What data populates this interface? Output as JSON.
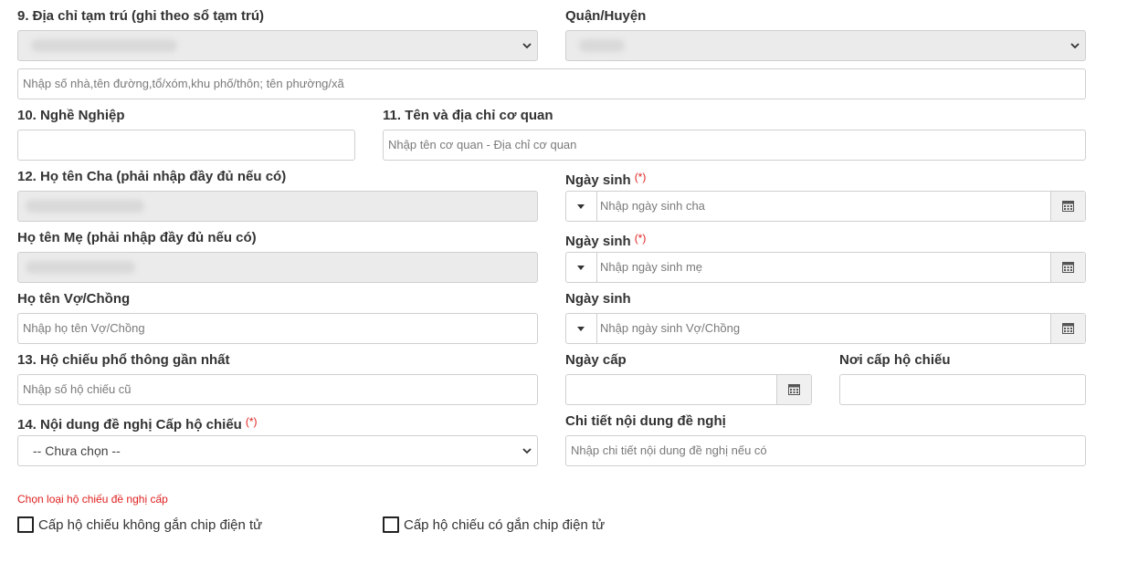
{
  "section9": {
    "label": "9. Địa chỉ tạm trú (ghi theo sổ tạm trú)",
    "district_label": "Quận/Huyện",
    "address_placeholder": "Nhập số nhà,tên đường,tổ/xóm,khu phố/thôn; tên phường/xã"
  },
  "section10": {
    "label": "10. Nghề Nghiệp"
  },
  "section11": {
    "label": "11. Tên và địa chỉ cơ quan",
    "placeholder": "Nhập tên cơ quan - Địa chỉ cơ quan"
  },
  "section12": {
    "father_label": "12. Họ tên Cha (phải nhập đầy đủ nếu có)",
    "father_dob_label": "Ngày sinh",
    "father_dob_placeholder": "Nhập ngày sinh cha",
    "mother_label": "Họ tên Mẹ (phải nhập đầy đủ nếu có)",
    "mother_dob_label": "Ngày sinh",
    "mother_dob_placeholder": "Nhập ngày sinh mẹ",
    "spouse_label": "Họ tên Vợ/Chồng",
    "spouse_placeholder": "Nhập họ tên Vợ/Chồng",
    "spouse_dob_label": "Ngày sinh",
    "spouse_dob_placeholder": "Nhập ngày sinh Vợ/Chồng",
    "required_mark": "(*)"
  },
  "section13": {
    "label": "13. Hộ chiếu phổ thông gần nhất",
    "placeholder": "Nhập số hộ chiếu cũ",
    "issue_date_label": "Ngày cấp",
    "issue_place_label": "Nơi cấp hộ chiếu"
  },
  "section14": {
    "label": "14. Nội dung đề nghị Cấp hộ chiếu",
    "required_mark": "(*)",
    "select_value": "-- Chưa chọn --",
    "detail_label": "Chi tiết nội dung đề nghị",
    "detail_placeholder": "Nhập chi tiết nội dung đề nghị nếu có"
  },
  "passport_type": {
    "prompt": "Chọn loại hộ chiếu đề nghị cấp",
    "option_no_chip": "Cấp hộ chiếu không gắn chip điện tử",
    "option_chip": "Cấp hộ chiếu có gắn chip điện tử"
  },
  "colors": {
    "required": "#e02020",
    "disabled_bg": "#ebebeb",
    "border": "#cfcfcf"
  },
  "icons": {
    "calendar": "calendar-icon",
    "chevron": "chevron-down-icon",
    "caret": "caret-down-icon"
  }
}
